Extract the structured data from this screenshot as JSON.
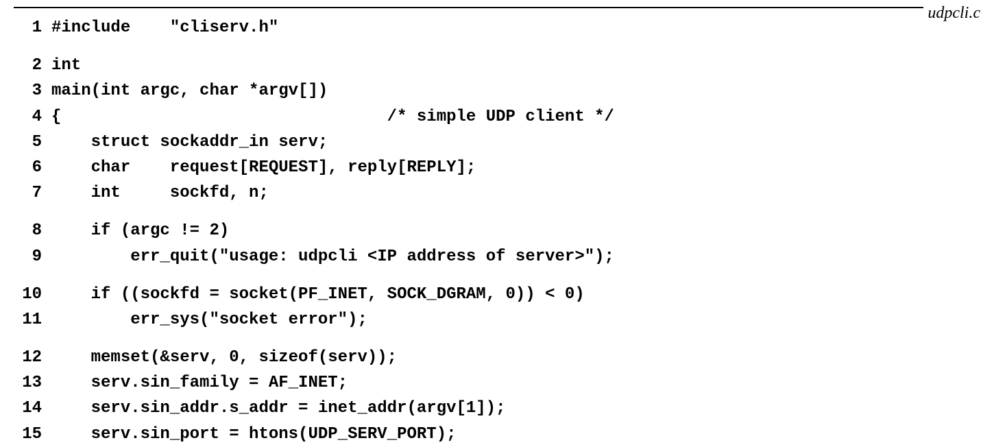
{
  "filename": "udpcli.c",
  "lines": [
    {
      "n": "1",
      "t": "#include    \"cliserv.h\""
    },
    {
      "gap": true
    },
    {
      "n": "2",
      "t": "int"
    },
    {
      "n": "3",
      "t": "main(int argc, char *argv[])"
    },
    {
      "n": "4",
      "t": "{                                 /* simple UDP client */"
    },
    {
      "n": "5",
      "t": "    struct sockaddr_in serv;"
    },
    {
      "n": "6",
      "t": "    char    request[REQUEST], reply[REPLY];"
    },
    {
      "n": "7",
      "t": "    int     sockfd, n;"
    },
    {
      "gap": true
    },
    {
      "n": "8",
      "t": "    if (argc != 2)"
    },
    {
      "n": "9",
      "t": "        err_quit(\"usage: udpcli <IP address of server>\");"
    },
    {
      "gap": true
    },
    {
      "n": "10",
      "t": "    if ((sockfd = socket(PF_INET, SOCK_DGRAM, 0)) < 0)"
    },
    {
      "n": "11",
      "t": "        err_sys(\"socket error\");"
    },
    {
      "gap": true
    },
    {
      "n": "12",
      "t": "    memset(&serv, 0, sizeof(serv));"
    },
    {
      "n": "13",
      "t": "    serv.sin_family = AF_INET;"
    },
    {
      "n": "14",
      "t": "    serv.sin_addr.s_addr = inet_addr(argv[1]);"
    },
    {
      "n": "15",
      "t": "    serv.sin_port = htons(UDP_SERV_PORT);"
    }
  ]
}
